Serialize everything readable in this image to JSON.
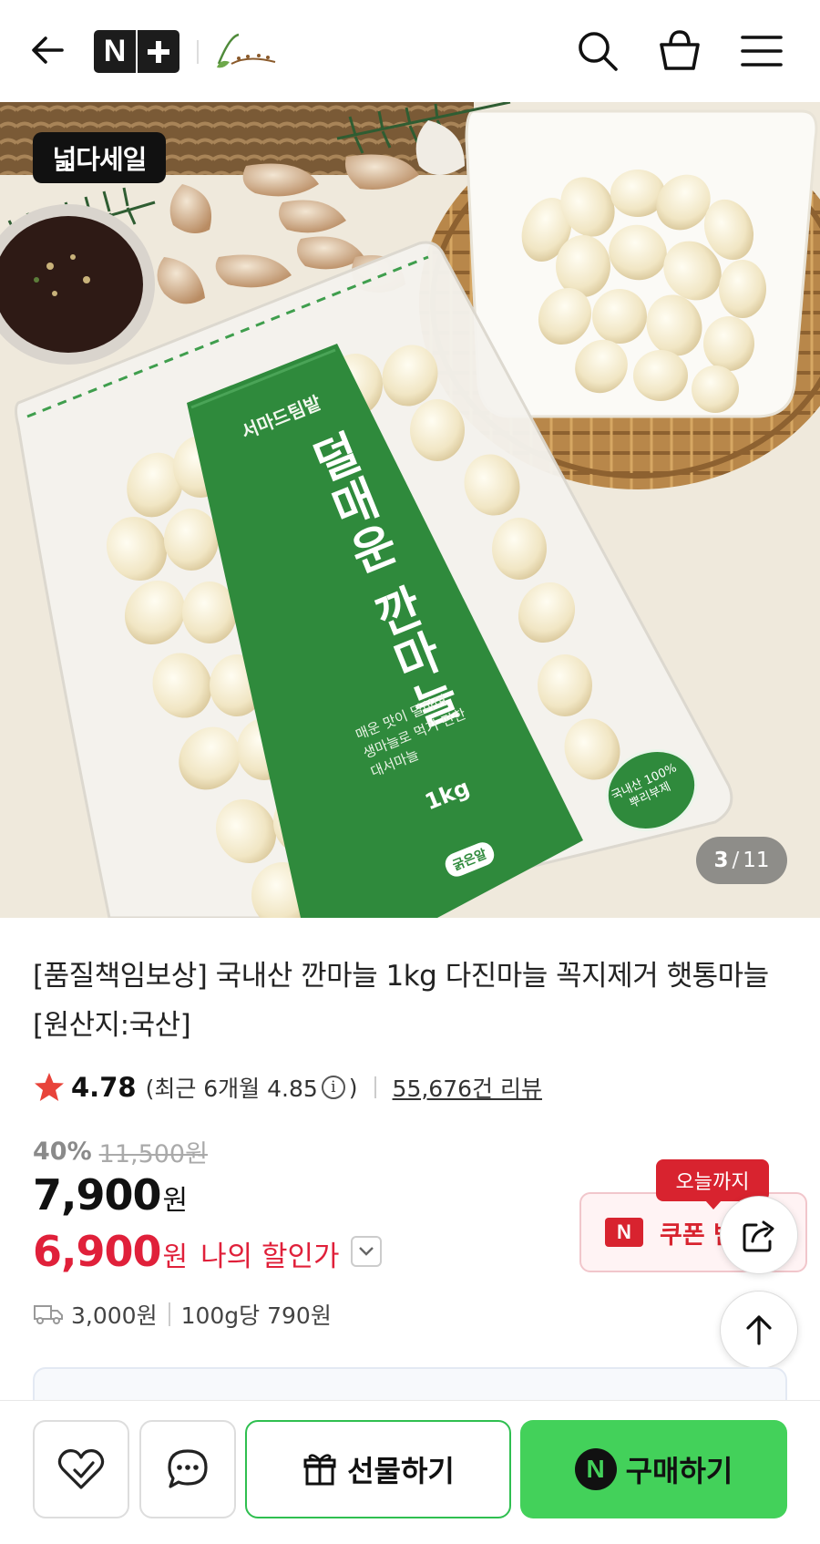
{
  "header": {
    "brand_badge_left": "N",
    "store_logo_alt": "store-logo"
  },
  "hero": {
    "sale_badge": "넓다세일",
    "counter_current": "3",
    "counter_sep": "/",
    "counter_total": "11",
    "package": {
      "brand": "서마드팀밭",
      "name": "덜매운 깐마늘",
      "desc_line1": "매운 맛이 덜하여",
      "desc_line2": "생마늘로 먹기 편한",
      "desc_line3": "대서마늘",
      "weight": "1kg",
      "size_label": "굵은알",
      "origin_line1": "국내산 100%",
      "origin_line2": "뿌리부제"
    }
  },
  "product": {
    "title": "[품질책임보상] 국내산 깐마늘 1kg 다진마늘 꼭지제거 햇통마늘 [원산지:국산]"
  },
  "rating": {
    "score": "4.78",
    "recent": "(최근 6개월 4.85",
    "recent_close": ")",
    "info_icon": "i",
    "reviews": "55,676건 리뷰"
  },
  "price": {
    "discount_pct": "40%",
    "original": "11,500원",
    "sale": "7,900",
    "won": "원",
    "my_price": "6,900",
    "my_won": "원",
    "my_label": "나의 할인가"
  },
  "coupon": {
    "tag": "오늘까지",
    "logo": "N",
    "label": "쿠폰 받기"
  },
  "shipping": {
    "fee": "3,000원",
    "unit_price": "100g당 790원"
  },
  "bottom_bar": {
    "gift_label": "선물하기",
    "buy_label": "구매하기",
    "buy_logo": "N"
  },
  "colors": {
    "accent_green": "#43d15a",
    "gift_border": "#2fbf50",
    "price_red": "#e0203a",
    "coupon_red": "#d8232f",
    "star": "#e8433a"
  },
  "icons": [
    "back-arrow-icon",
    "search-icon",
    "cart-icon",
    "menu-icon",
    "star-icon",
    "chevron-down-icon",
    "truck-icon",
    "share-icon",
    "arrow-up-icon",
    "heart-icon",
    "chat-icon",
    "gift-icon"
  ]
}
